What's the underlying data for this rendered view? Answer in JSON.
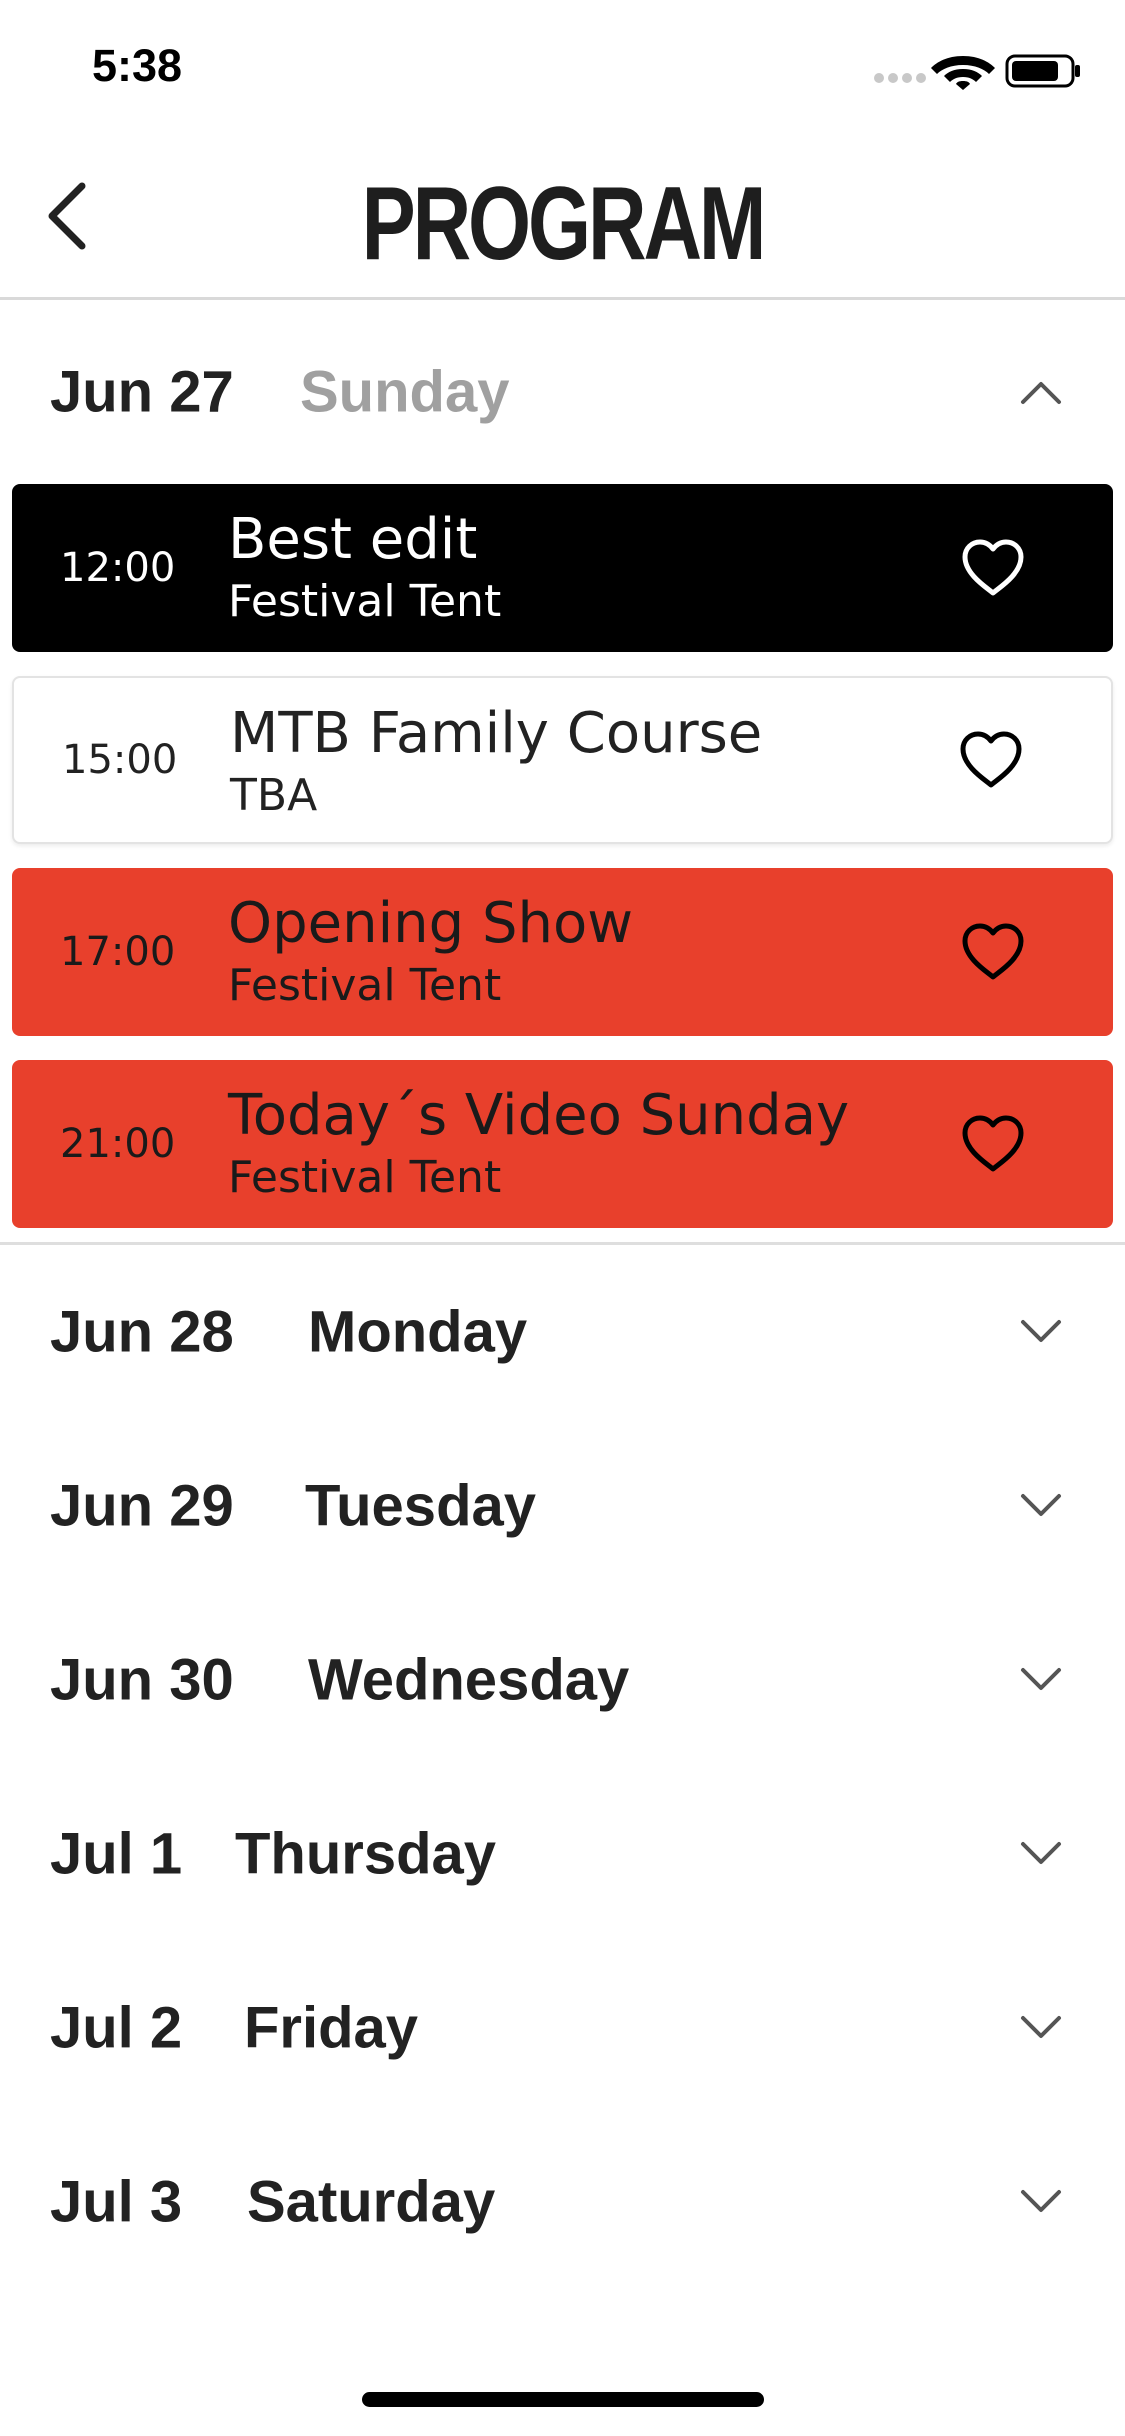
{
  "status_bar": {
    "time": "5:38",
    "icons": [
      "signal-icon",
      "wifi-icon",
      "battery-icon"
    ]
  },
  "nav": {
    "title": "PROGRAM",
    "back_icon": "chevron-left-icon"
  },
  "colors": {
    "black_card": "#000000",
    "red_card": "#e8402c",
    "muted_text": "#a0a0a0"
  },
  "days": [
    {
      "date": "Jun 27",
      "weekday": "Sunday",
      "expanded": true,
      "events": [
        {
          "time": "12:00",
          "title": "Best edit",
          "location": "Festival Tent",
          "style": "black"
        },
        {
          "time": "15:00",
          "title": "MTB Family Course",
          "location": "TBA",
          "style": "white"
        },
        {
          "time": "17:00",
          "title": "Opening Show",
          "location": "Festival Tent",
          "style": "red"
        },
        {
          "time": "21:00",
          "title": "Today´s Video Sunday",
          "location": "Festival Tent",
          "style": "red"
        }
      ]
    },
    {
      "date": "Jun 28",
      "weekday": "Monday",
      "expanded": false
    },
    {
      "date": "Jun 29",
      "weekday": "Tuesday",
      "expanded": false
    },
    {
      "date": "Jun 30",
      "weekday": "Wednesday",
      "expanded": false
    },
    {
      "date": "Jul 1",
      "weekday": "Thursday",
      "expanded": false
    },
    {
      "date": "Jul 2",
      "weekday": "Friday",
      "expanded": false
    },
    {
      "date": "Jul 3",
      "weekday": "Saturday",
      "expanded": false
    }
  ]
}
